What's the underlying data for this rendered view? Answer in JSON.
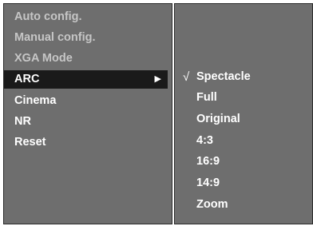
{
  "main_menu": {
    "items": [
      {
        "label": "Auto config.",
        "state": "disabled"
      },
      {
        "label": "Manual config.",
        "state": "disabled"
      },
      {
        "label": "XGA Mode",
        "state": "disabled"
      },
      {
        "label": "ARC",
        "state": "selected",
        "submenu_icon": "right-triangle-icon"
      },
      {
        "label": "Cinema",
        "state": "enabled"
      },
      {
        "label": "NR",
        "state": "enabled"
      },
      {
        "label": "Reset",
        "state": "enabled"
      }
    ]
  },
  "arc_submenu": {
    "check_mark": "√",
    "checked_item": "Spectacle",
    "items": [
      {
        "label": "Spectacle"
      },
      {
        "label": "Full"
      },
      {
        "label": "Original"
      },
      {
        "label": "4:3"
      },
      {
        "label": "16:9"
      },
      {
        "label": "14:9"
      },
      {
        "label": "Zoom"
      }
    ]
  },
  "colors": {
    "panel_background": "#6e6e6e",
    "selected_background": "#1a1a1a",
    "enabled_text": "#ffffff",
    "disabled_text": "#c6c6c6"
  }
}
